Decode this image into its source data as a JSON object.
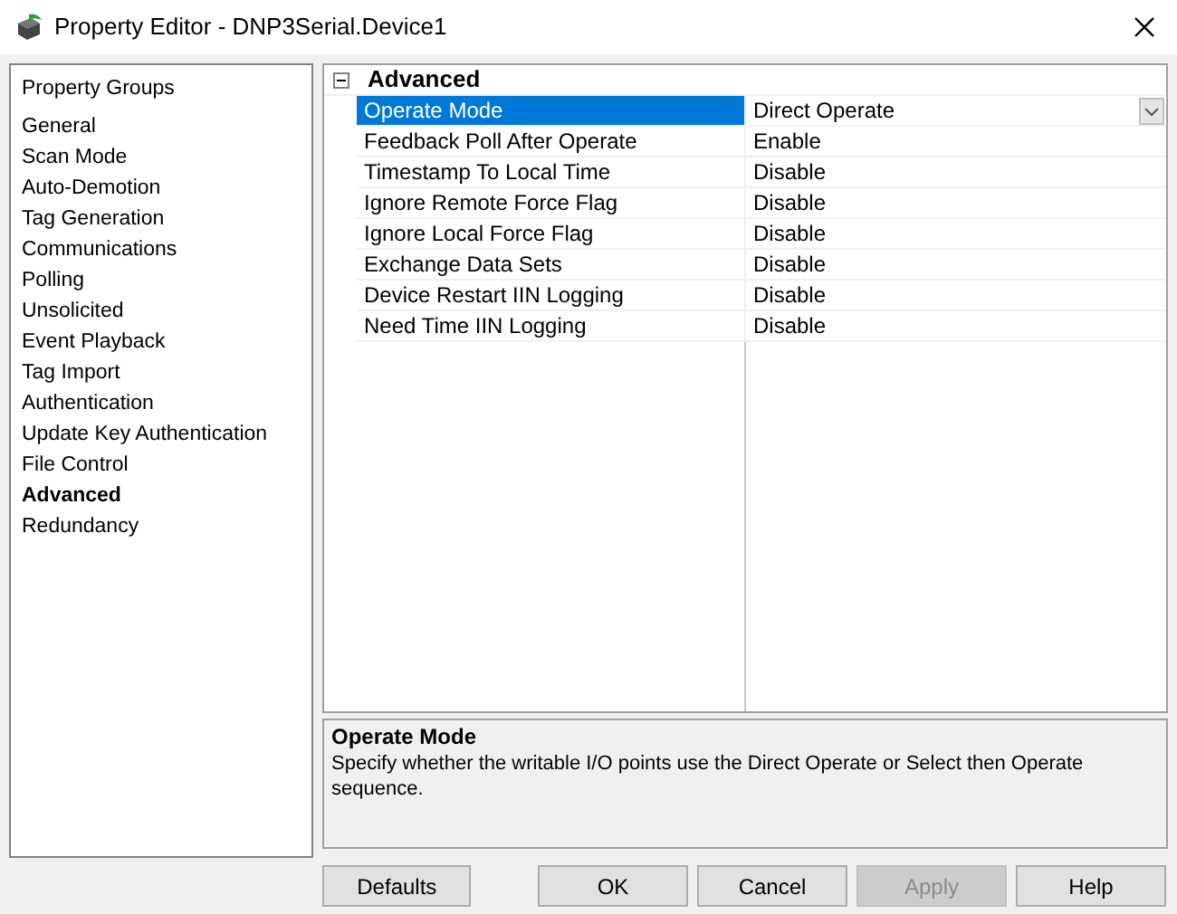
{
  "window": {
    "title": "Property Editor - DNP3Serial.Device1"
  },
  "sidebar": {
    "title": "Property Groups",
    "items": [
      {
        "label": "General",
        "selected": false
      },
      {
        "label": "Scan Mode",
        "selected": false
      },
      {
        "label": "Auto-Demotion",
        "selected": false
      },
      {
        "label": "Tag Generation",
        "selected": false
      },
      {
        "label": "Communications",
        "selected": false
      },
      {
        "label": "Polling",
        "selected": false
      },
      {
        "label": "Unsolicited",
        "selected": false
      },
      {
        "label": "Event Playback",
        "selected": false
      },
      {
        "label": "Tag Import",
        "selected": false
      },
      {
        "label": "Authentication",
        "selected": false
      },
      {
        "label": "Update Key Authentication",
        "selected": false
      },
      {
        "label": "File Control",
        "selected": false
      },
      {
        "label": "Advanced",
        "selected": true
      },
      {
        "label": "Redundancy",
        "selected": false
      }
    ]
  },
  "property_grid": {
    "group": {
      "title": "Advanced",
      "expanded": true
    },
    "rows": [
      {
        "name": "Operate Mode",
        "value": "Direct Operate",
        "selected": true
      },
      {
        "name": "Feedback Poll After Operate",
        "value": "Enable",
        "selected": false
      },
      {
        "name": "Timestamp To Local Time",
        "value": "Disable",
        "selected": false
      },
      {
        "name": "Ignore Remote Force Flag",
        "value": "Disable",
        "selected": false
      },
      {
        "name": "Ignore Local Force Flag",
        "value": "Disable",
        "selected": false
      },
      {
        "name": "Exchange Data Sets",
        "value": "Disable",
        "selected": false
      },
      {
        "name": "Device Restart IIN Logging",
        "value": "Disable",
        "selected": false
      },
      {
        "name": "Need Time IIN Logging",
        "value": "Disable",
        "selected": false
      }
    ]
  },
  "description": {
    "title": "Operate Mode",
    "text": "Specify whether the writable I/O points use the Direct Operate or Select then Operate sequence."
  },
  "buttons": [
    {
      "label": "Defaults",
      "disabled": false
    },
    {
      "label": "OK",
      "disabled": false
    },
    {
      "label": "Cancel",
      "disabled": false
    },
    {
      "label": "Apply",
      "disabled": true
    },
    {
      "label": "Help",
      "disabled": false
    }
  ]
}
